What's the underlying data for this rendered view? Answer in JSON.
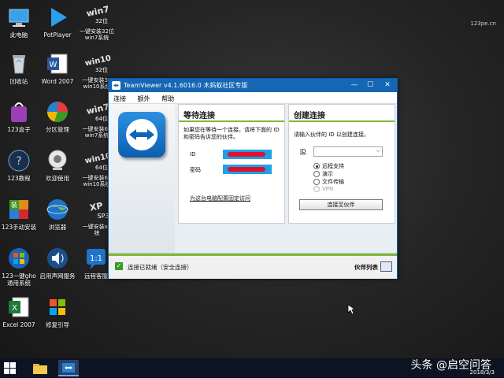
{
  "desktop": {
    "watermark_top": "123pe.cn",
    "icons": [
      {
        "name": "this-pc",
        "label": "此电脑"
      },
      {
        "name": "potplayer",
        "label": "PotPlayer"
      },
      {
        "name": "recycle-bin",
        "label": "回收站"
      },
      {
        "name": "word-2007",
        "label": "Word 2007"
      },
      {
        "name": "123-box",
        "label": "123盒子"
      },
      {
        "name": "partition-manager",
        "label": "分区管理"
      },
      {
        "name": "123-tutorial",
        "label": "123教程"
      },
      {
        "name": "welcome",
        "label": "欢迎使用"
      },
      {
        "name": "123-manual-install",
        "label": "123手动安装"
      },
      {
        "name": "browser",
        "label": "浏览器"
      },
      {
        "name": "123-gho",
        "label": "123一键gho\n通用系统"
      },
      {
        "name": "enable-sound",
        "label": "启用声网服务"
      },
      {
        "name": "remote-assist",
        "label": "远程客服"
      },
      {
        "name": "excel-2007",
        "label": "Excel 2007"
      },
      {
        "name": "repair-boot",
        "label": "修复引导"
      }
    ],
    "win_icons": [
      {
        "big": "win7",
        "small": "32位",
        "label": "一键安装32位\nwin7系统"
      },
      {
        "big": "win10",
        "small": "32位",
        "label": "一键安装32\nwin10系统"
      },
      {
        "big": "win7",
        "small": "64位",
        "label": "一键安装64\nwin7系统"
      },
      {
        "big": "win10",
        "small": "64位",
        "label": "一键安装64\nwin10系统"
      },
      {
        "big": "XP",
        "small": "SP3",
        "label": "一键安装xp\n统"
      }
    ]
  },
  "teamviewer": {
    "title": "TeamViewer v4.1.6016.0 木蚂蚁社区专版",
    "menu": [
      "连接",
      "额外",
      "帮助"
    ],
    "wait_panel": {
      "heading": "等待连接",
      "desc": "如果您在等待一个连接，请将下面的 ID 和密码告诉您的伙伴。",
      "id_label": "ID",
      "password_label": "密码",
      "link": "为这台电脑配置固定访问"
    },
    "create_panel": {
      "heading": "创建连接",
      "desc": "请输入伙伴的 ID 以创建连接。",
      "id_label": "ID",
      "options": [
        {
          "label": "远程支持",
          "selected": true,
          "disabled": false
        },
        {
          "label": "演示",
          "selected": false,
          "disabled": false
        },
        {
          "label": "文件传输",
          "selected": false,
          "disabled": false
        },
        {
          "label": "VPN",
          "selected": false,
          "disabled": true
        }
      ],
      "connect_button": "连接至伙伴"
    },
    "status": {
      "text": "连接已就绪（安全连接）",
      "partners": "伙伴列表"
    }
  },
  "taskbar": {
    "watermark": "头条 @启空问答",
    "date": "2018/3/3"
  }
}
